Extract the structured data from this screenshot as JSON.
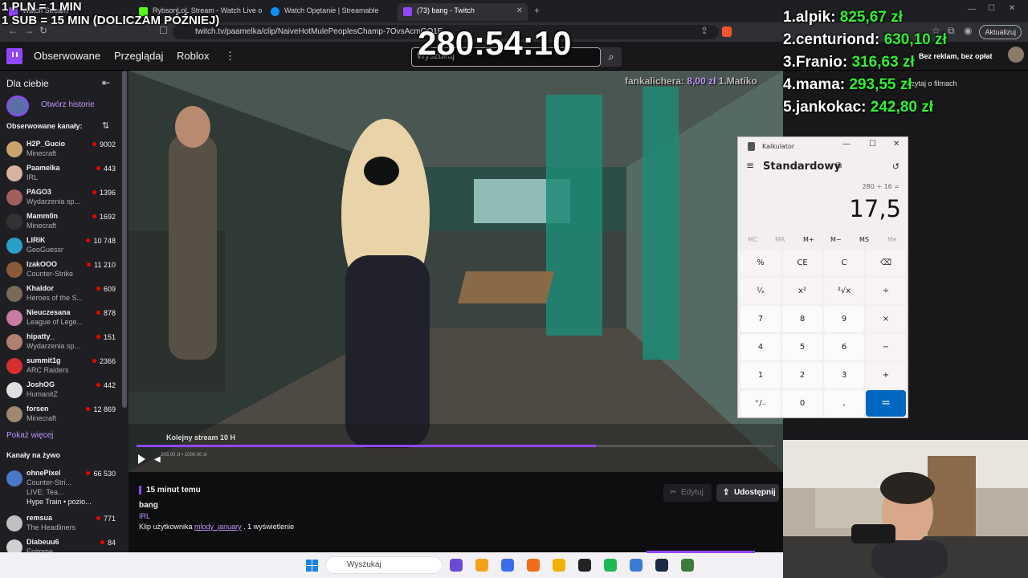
{
  "browser": {
    "tabs": [
      {
        "label": "Watch Stream",
        "icon_color": "#9147ff"
      },
      {
        "label": "RybsonLoL Stream - Watch Live on K",
        "icon_color": "#53fc18"
      },
      {
        "label": "Watch Opętanie | Streamable",
        "icon_color": "#0f90fa"
      },
      {
        "label": "(73) bang - Twitch",
        "icon_color": "#9147ff"
      }
    ],
    "url": "twitch.tv/paamelka/clip/NaiveHotMulePeoplesChamp-7OvsAcmQO1E...",
    "update_label": "Aktualizuj",
    "badges": [
      "28",
      "73",
      "2"
    ]
  },
  "twitch": {
    "nav": [
      "Obserwowane",
      "Przeglądaj",
      "Roblox"
    ],
    "more_icon": "⋮",
    "search_placeholder": "Wyszukaj",
    "no_ads_label": "Bez reklam, bez opłat",
    "films_label": "Czytaj o filmach"
  },
  "sidebar": {
    "heading": "Dla ciebie",
    "stories_label": "Otwórz historie",
    "followed_heading": "Obserwowane kanały:",
    "followed": [
      {
        "name": "H2P_Gucio",
        "game": "Minecraft",
        "viewers": "9002",
        "color": "#c9a36b"
      },
      {
        "name": "Paamelka",
        "game": "IRL",
        "viewers": "443",
        "color": "#d7b3a1"
      },
      {
        "name": "PAGO3",
        "game": "Wydarzenia sp...",
        "viewers": "1396",
        "color": "#a06060"
      },
      {
        "name": "Mamm0n",
        "game": "Minecraft",
        "viewers": "1692",
        "color": "#333333"
      },
      {
        "name": "LIRIK",
        "game": "GeoGuessr",
        "viewers": "10 748",
        "color": "#2aa0c8"
      },
      {
        "name": "IzakOOO",
        "game": "Counter-Strike",
        "viewers": "11 210",
        "color": "#8a5a3a"
      },
      {
        "name": "Khaldor",
        "game": "Heroes of the S...",
        "viewers": "609",
        "color": "#7a6a5a"
      },
      {
        "name": "Nieuczesana",
        "game": "League of Lege...",
        "viewers": "878",
        "color": "#c87aa0"
      },
      {
        "name": "hipatty_",
        "game": "Wydarzenia sp...",
        "viewers": "151",
        "color": "#b08070"
      },
      {
        "name": "summit1g",
        "game": "ARC Raiders",
        "viewers": "2366",
        "color": "#d32f2f"
      },
      {
        "name": "JoshOG",
        "game": "HumanitZ",
        "viewers": "442",
        "color": "#e0e0e0"
      },
      {
        "name": "forsen",
        "game": "Minecraft",
        "viewers": "12 869",
        "color": "#a08870"
      }
    ],
    "show_more": "Pokaż więcej",
    "live_heading": "Kanały na żywo",
    "live": [
      {
        "name": "ohnePixel",
        "game": "Counter-Stri...",
        "viewers": "66 530",
        "color": "#4a78c8",
        "extra1": "LIVE: Tea...",
        "extra2": "Hype Train • pozio..."
      },
      {
        "name": "remsua",
        "game": "The Headliners",
        "viewers": "771",
        "color": "#c0c0c0"
      },
      {
        "name": "Diabeuu6",
        "game": "Epitome",
        "viewers": "84",
        "color": "#d0d0d0"
      }
    ]
  },
  "video": {
    "caption": "Kolejny stream 10 H",
    "time": "203,00 zł • 1000,00 zł",
    "marker": "9",
    "progress": 0.72
  },
  "clip": {
    "posted": "15 minut temu",
    "title": "bang",
    "category": "IRL",
    "meta_prefix": "Klip użytkownika",
    "author": "mlody_january",
    "meta_suffix": ". 1 wyświetlenie",
    "edit_label": "Edytuj",
    "share_label": "Udostępnij"
  },
  "overlay": {
    "rate1": "1 PLN = 1 MIN",
    "rate2": "1 SUB = 15 MIN (DOLICZAM PÓŹNIEJ)",
    "timer": "280:54:10",
    "ticker_name": "fankalichera:",
    "ticker_amount": "8,00 zł",
    "ticker_next": "1.Matiko",
    "top_donors": [
      {
        "rank": "1.",
        "name": "alpik:",
        "amount": "825,67 zł"
      },
      {
        "rank": "2.",
        "name": "centuriond:",
        "amount": "630,10 zł"
      },
      {
        "rank": "3.",
        "name": "Franio:",
        "amount": "316,63 zł"
      },
      {
        "rank": "4.",
        "name": "mama:",
        "amount": "293,55 zł"
      },
      {
        "rank": "5.",
        "name": "jankokac:",
        "amount": "242,80 zł"
      }
    ]
  },
  "calculator": {
    "title": "Kalkulator",
    "mode": "Standardowy",
    "expression": "280 ÷ 16 =",
    "result": "17,5",
    "memory": [
      "MC",
      "MR",
      "M+",
      "M−",
      "MS",
      "M▾"
    ],
    "memory_enabled": [
      false,
      false,
      true,
      true,
      true,
      false
    ],
    "keys": [
      [
        "%",
        "CE",
        "C",
        "⌫"
      ],
      [
        "¹⁄ₓ",
        "x²",
        "²√x",
        "÷"
      ],
      [
        "7",
        "8",
        "9",
        "×"
      ],
      [
        "4",
        "5",
        "6",
        "−"
      ],
      [
        "1",
        "2",
        "3",
        "+"
      ],
      [
        "⁺/₋",
        "0",
        ",",
        "="
      ]
    ]
  },
  "taskbar": {
    "search_label": "Wyszukaj",
    "apps": [
      "#6a4bd6",
      "#f3a21a",
      "#3a6ee8",
      "#f06e1a",
      "#f0b400",
      "#222",
      "#1db954",
      "#3a7bd5",
      "#1a2a44",
      "#3d7a3d"
    ]
  }
}
